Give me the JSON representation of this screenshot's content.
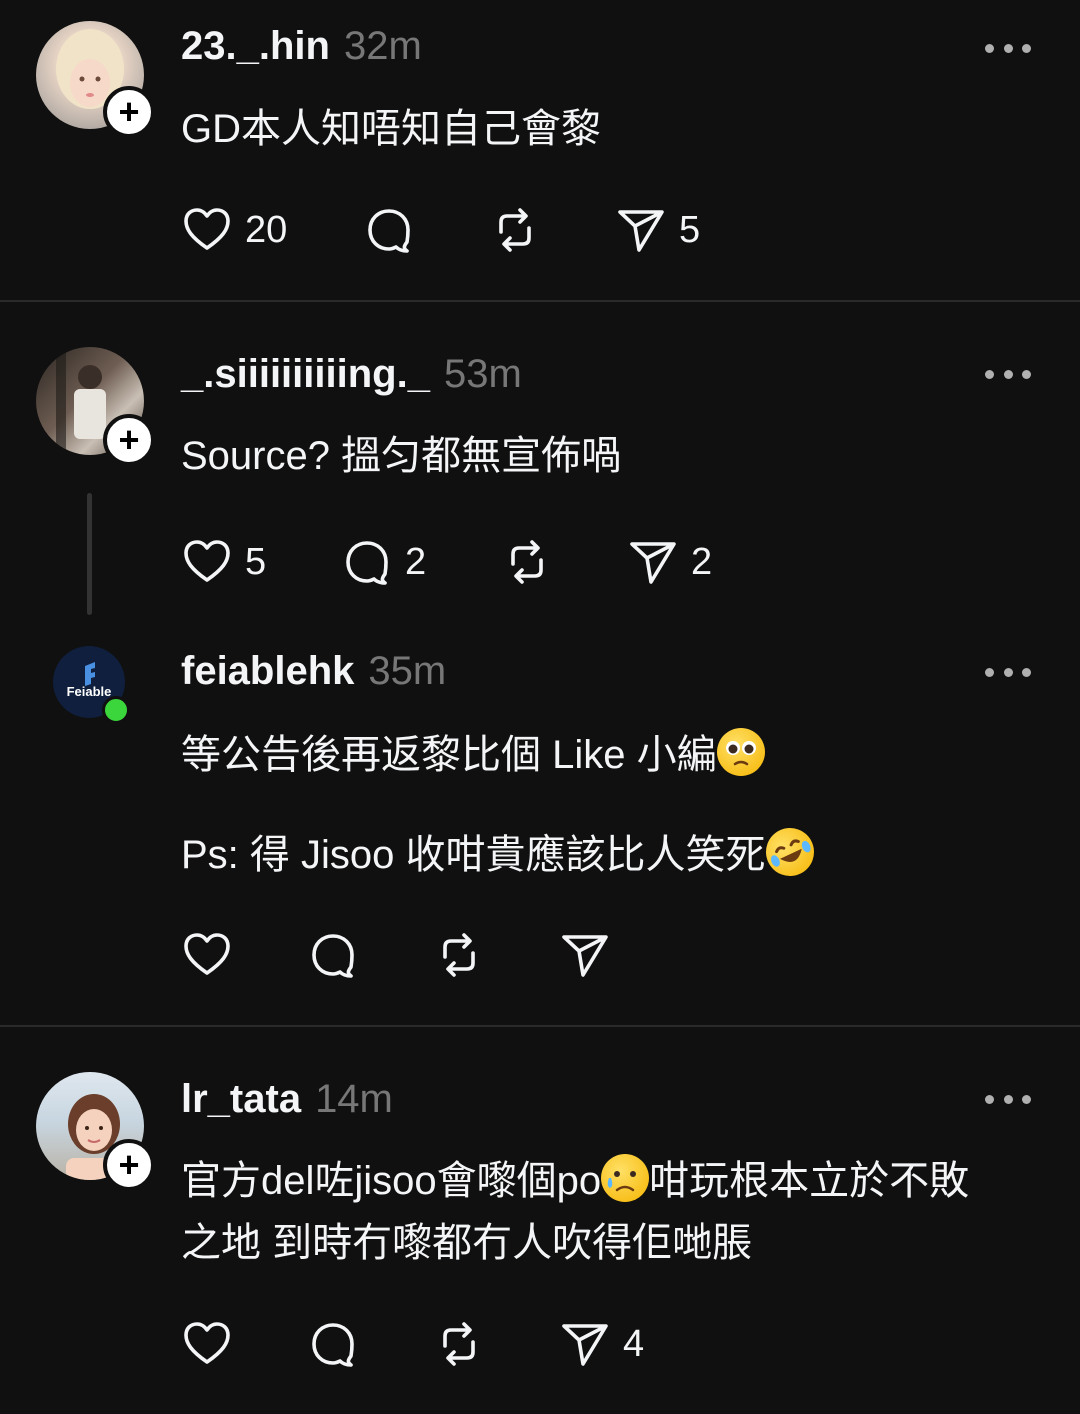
{
  "posts": [
    {
      "username": "23._.hin",
      "time": "32m",
      "text_lines": [
        "GD本人知唔知自己會黎"
      ],
      "likes": "20",
      "comments": "",
      "reposts": "",
      "shares": "5"
    },
    {
      "username": "_.siiiiiiiiiing._",
      "time": "53m",
      "text_lines": [
        "Source? 搵匀都無宣佈喎"
      ],
      "likes": "5",
      "comments": "2",
      "reposts": "",
      "shares": "2"
    },
    {
      "username": "feiablehk",
      "time": "35m",
      "avatar_text": "Feiable",
      "text_lines": [
        "等公告後再返黎比個 Like 小編",
        "Ps: 得 Jisoo 收咁貴應該比人笑死"
      ],
      "likes": "",
      "comments": "",
      "reposts": "",
      "shares": ""
    },
    {
      "username": "lr_tata",
      "time": "14m",
      "text_lines": [
        "官方del咗jisoo會嚟個po",
        "咁玩根本立於不敗",
        "之地 到時冇嚟都冇人吹得佢哋脹"
      ],
      "likes": "",
      "comments": "",
      "reposts": "",
      "shares": "4"
    }
  ],
  "emojis": {
    "pleading": "pleading-face-emoji",
    "rofl": "rolling-on-floor-laughing-emoji",
    "sad": "sad-but-relieved-face-emoji"
  },
  "colors": {
    "background": "#101010",
    "text": "#f3f5f7",
    "muted": "#777777",
    "online": "#3bd63b",
    "feiable_bg": "#0f1f3d"
  }
}
